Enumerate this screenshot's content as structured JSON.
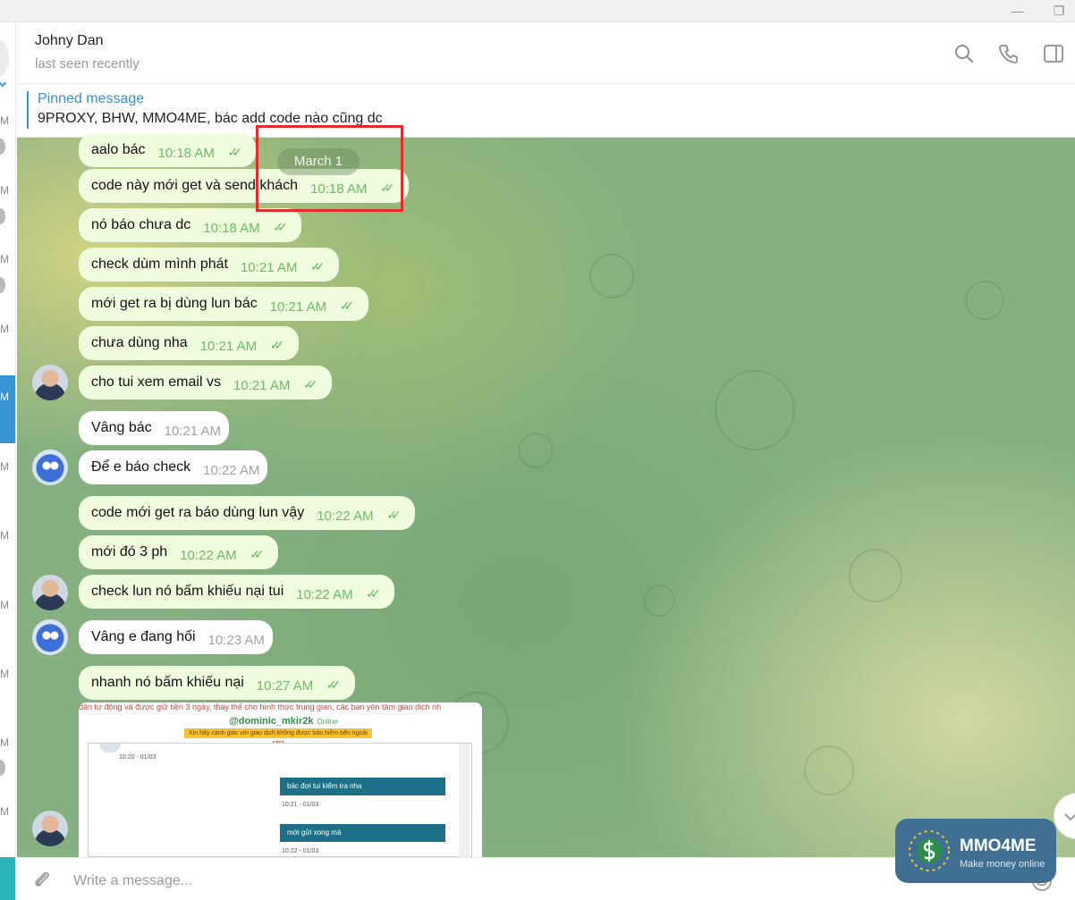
{
  "window": {
    "minimize_glyph": "—",
    "restore_glyph": "❐"
  },
  "sidebar": {
    "peek_label": "M",
    "active_label": "M"
  },
  "header": {
    "name": "Johny Dan",
    "status": "last seen recently",
    "icons": [
      "search-icon",
      "phone-icon",
      "sidebar-toggle-icon"
    ]
  },
  "pinned": {
    "title": "Pinned message",
    "text": "9PROXY, BHW, MMO4ME, bác add code nào cũng dc"
  },
  "date_divider": "March 1",
  "messages": [
    {
      "text": "aalo bác",
      "time": "10:18 AM",
      "dir": "out",
      "read": true
    },
    {
      "text": "code này mới get và send khách",
      "time": "10:18 AM",
      "dir": "out",
      "read": true
    },
    {
      "text": "nó báo chưa dc",
      "time": "10:18 AM",
      "dir": "out",
      "read": true
    },
    {
      "text": "check dùm mình phát",
      "time": "10:21 AM",
      "dir": "out",
      "read": true
    },
    {
      "text": "mới get ra bị dùng lun bác",
      "time": "10:21 AM",
      "dir": "out",
      "read": true
    },
    {
      "text": "chưa dùng nha",
      "time": "10:21 AM",
      "dir": "out",
      "read": true
    },
    {
      "text": "cho tui xem email vs",
      "time": "10:21 AM",
      "dir": "out",
      "read": true
    },
    {
      "text": "Vâng bác",
      "time": "10:21 AM",
      "dir": "in"
    },
    {
      "text": "Để e báo check",
      "time": "10:22 AM",
      "dir": "in"
    },
    {
      "text": "code mới get ra báo dùng lun vậy",
      "time": "10:22 AM",
      "dir": "out",
      "read": true
    },
    {
      "text": "mới đó 3 ph",
      "time": "10:22 AM",
      "dir": "out",
      "read": true
    },
    {
      "text": "check lun nó bấm khiếu nại tui",
      "time": "10:22 AM",
      "dir": "out",
      "read": true
    },
    {
      "text": "Vâng e đang hối",
      "time": "10:23 AM",
      "dir": "in"
    },
    {
      "text": "nhanh nó bấm khiếu nại",
      "time": "10:27 AM",
      "dir": "out",
      "read": true
    }
  ],
  "image_message": {
    "top_text": "dân tự động và được giữ tiền 3 ngày, thay thế cho hình thức trung gian, các bạn yên tâm giao dịch nh",
    "username": "@dominic_mkir2k",
    "online": "Online",
    "warning": "Xin hãy cảnh giác với giao dịch không được bảo hiểm bên ngoài sàn!",
    "entries": [
      {
        "time": "10:20 - 01/03"
      },
      {
        "text": "bác đợi tui kiểm tra nha",
        "time": "10:21 - 01/03"
      },
      {
        "text": "mới gửi xong mà",
        "time": "10:22 - 01/03"
      }
    ]
  },
  "input": {
    "placeholder": "Write a message..."
  },
  "watermark": {
    "name": "MMO4ME",
    "tagline": "Make money online"
  },
  "colors": {
    "accent": "#3a95d4",
    "outgoing_bubble": "#effdde",
    "incoming_bubble": "#ffffff",
    "check": "#5fb55a",
    "highlight_box": "#e52b2b"
  }
}
